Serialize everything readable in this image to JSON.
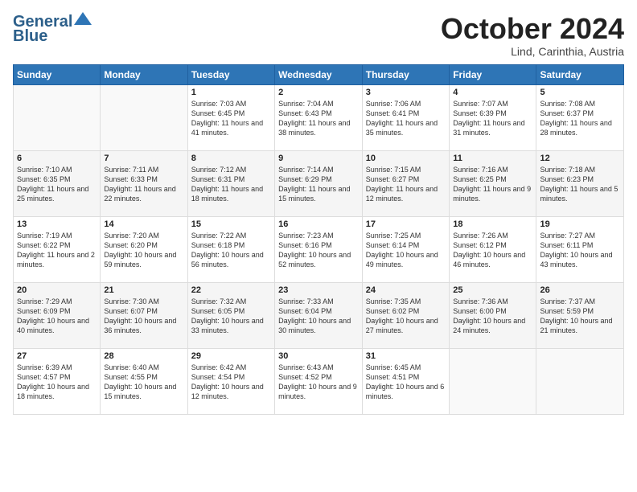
{
  "header": {
    "logo_line1": "General",
    "logo_line2": "Blue",
    "month": "October 2024",
    "location": "Lind, Carinthia, Austria"
  },
  "weekdays": [
    "Sunday",
    "Monday",
    "Tuesday",
    "Wednesday",
    "Thursday",
    "Friday",
    "Saturday"
  ],
  "weeks": [
    [
      {
        "day": "",
        "sunrise": "",
        "sunset": "",
        "daylight": ""
      },
      {
        "day": "",
        "sunrise": "",
        "sunset": "",
        "daylight": ""
      },
      {
        "day": "1",
        "sunrise": "Sunrise: 7:03 AM",
        "sunset": "Sunset: 6:45 PM",
        "daylight": "Daylight: 11 hours and 41 minutes."
      },
      {
        "day": "2",
        "sunrise": "Sunrise: 7:04 AM",
        "sunset": "Sunset: 6:43 PM",
        "daylight": "Daylight: 11 hours and 38 minutes."
      },
      {
        "day": "3",
        "sunrise": "Sunrise: 7:06 AM",
        "sunset": "Sunset: 6:41 PM",
        "daylight": "Daylight: 11 hours and 35 minutes."
      },
      {
        "day": "4",
        "sunrise": "Sunrise: 7:07 AM",
        "sunset": "Sunset: 6:39 PM",
        "daylight": "Daylight: 11 hours and 31 minutes."
      },
      {
        "day": "5",
        "sunrise": "Sunrise: 7:08 AM",
        "sunset": "Sunset: 6:37 PM",
        "daylight": "Daylight: 11 hours and 28 minutes."
      }
    ],
    [
      {
        "day": "6",
        "sunrise": "Sunrise: 7:10 AM",
        "sunset": "Sunset: 6:35 PM",
        "daylight": "Daylight: 11 hours and 25 minutes."
      },
      {
        "day": "7",
        "sunrise": "Sunrise: 7:11 AM",
        "sunset": "Sunset: 6:33 PM",
        "daylight": "Daylight: 11 hours and 22 minutes."
      },
      {
        "day": "8",
        "sunrise": "Sunrise: 7:12 AM",
        "sunset": "Sunset: 6:31 PM",
        "daylight": "Daylight: 11 hours and 18 minutes."
      },
      {
        "day": "9",
        "sunrise": "Sunrise: 7:14 AM",
        "sunset": "Sunset: 6:29 PM",
        "daylight": "Daylight: 11 hours and 15 minutes."
      },
      {
        "day": "10",
        "sunrise": "Sunrise: 7:15 AM",
        "sunset": "Sunset: 6:27 PM",
        "daylight": "Daylight: 11 hours and 12 minutes."
      },
      {
        "day": "11",
        "sunrise": "Sunrise: 7:16 AM",
        "sunset": "Sunset: 6:25 PM",
        "daylight": "Daylight: 11 hours and 9 minutes."
      },
      {
        "day": "12",
        "sunrise": "Sunrise: 7:18 AM",
        "sunset": "Sunset: 6:23 PM",
        "daylight": "Daylight: 11 hours and 5 minutes."
      }
    ],
    [
      {
        "day": "13",
        "sunrise": "Sunrise: 7:19 AM",
        "sunset": "Sunset: 6:22 PM",
        "daylight": "Daylight: 11 hours and 2 minutes."
      },
      {
        "day": "14",
        "sunrise": "Sunrise: 7:20 AM",
        "sunset": "Sunset: 6:20 PM",
        "daylight": "Daylight: 10 hours and 59 minutes."
      },
      {
        "day": "15",
        "sunrise": "Sunrise: 7:22 AM",
        "sunset": "Sunset: 6:18 PM",
        "daylight": "Daylight: 10 hours and 56 minutes."
      },
      {
        "day": "16",
        "sunrise": "Sunrise: 7:23 AM",
        "sunset": "Sunset: 6:16 PM",
        "daylight": "Daylight: 10 hours and 52 minutes."
      },
      {
        "day": "17",
        "sunrise": "Sunrise: 7:25 AM",
        "sunset": "Sunset: 6:14 PM",
        "daylight": "Daylight: 10 hours and 49 minutes."
      },
      {
        "day": "18",
        "sunrise": "Sunrise: 7:26 AM",
        "sunset": "Sunset: 6:12 PM",
        "daylight": "Daylight: 10 hours and 46 minutes."
      },
      {
        "day": "19",
        "sunrise": "Sunrise: 7:27 AM",
        "sunset": "Sunset: 6:11 PM",
        "daylight": "Daylight: 10 hours and 43 minutes."
      }
    ],
    [
      {
        "day": "20",
        "sunrise": "Sunrise: 7:29 AM",
        "sunset": "Sunset: 6:09 PM",
        "daylight": "Daylight: 10 hours and 40 minutes."
      },
      {
        "day": "21",
        "sunrise": "Sunrise: 7:30 AM",
        "sunset": "Sunset: 6:07 PM",
        "daylight": "Daylight: 10 hours and 36 minutes."
      },
      {
        "day": "22",
        "sunrise": "Sunrise: 7:32 AM",
        "sunset": "Sunset: 6:05 PM",
        "daylight": "Daylight: 10 hours and 33 minutes."
      },
      {
        "day": "23",
        "sunrise": "Sunrise: 7:33 AM",
        "sunset": "Sunset: 6:04 PM",
        "daylight": "Daylight: 10 hours and 30 minutes."
      },
      {
        "day": "24",
        "sunrise": "Sunrise: 7:35 AM",
        "sunset": "Sunset: 6:02 PM",
        "daylight": "Daylight: 10 hours and 27 minutes."
      },
      {
        "day": "25",
        "sunrise": "Sunrise: 7:36 AM",
        "sunset": "Sunset: 6:00 PM",
        "daylight": "Daylight: 10 hours and 24 minutes."
      },
      {
        "day": "26",
        "sunrise": "Sunrise: 7:37 AM",
        "sunset": "Sunset: 5:59 PM",
        "daylight": "Daylight: 10 hours and 21 minutes."
      }
    ],
    [
      {
        "day": "27",
        "sunrise": "Sunrise: 6:39 AM",
        "sunset": "Sunset: 4:57 PM",
        "daylight": "Daylight: 10 hours and 18 minutes."
      },
      {
        "day": "28",
        "sunrise": "Sunrise: 6:40 AM",
        "sunset": "Sunset: 4:55 PM",
        "daylight": "Daylight: 10 hours and 15 minutes."
      },
      {
        "day": "29",
        "sunrise": "Sunrise: 6:42 AM",
        "sunset": "Sunset: 4:54 PM",
        "daylight": "Daylight: 10 hours and 12 minutes."
      },
      {
        "day": "30",
        "sunrise": "Sunrise: 6:43 AM",
        "sunset": "Sunset: 4:52 PM",
        "daylight": "Daylight: 10 hours and 9 minutes."
      },
      {
        "day": "31",
        "sunrise": "Sunrise: 6:45 AM",
        "sunset": "Sunset: 4:51 PM",
        "daylight": "Daylight: 10 hours and 6 minutes."
      },
      {
        "day": "",
        "sunrise": "",
        "sunset": "",
        "daylight": ""
      },
      {
        "day": "",
        "sunrise": "",
        "sunset": "",
        "daylight": ""
      }
    ]
  ]
}
